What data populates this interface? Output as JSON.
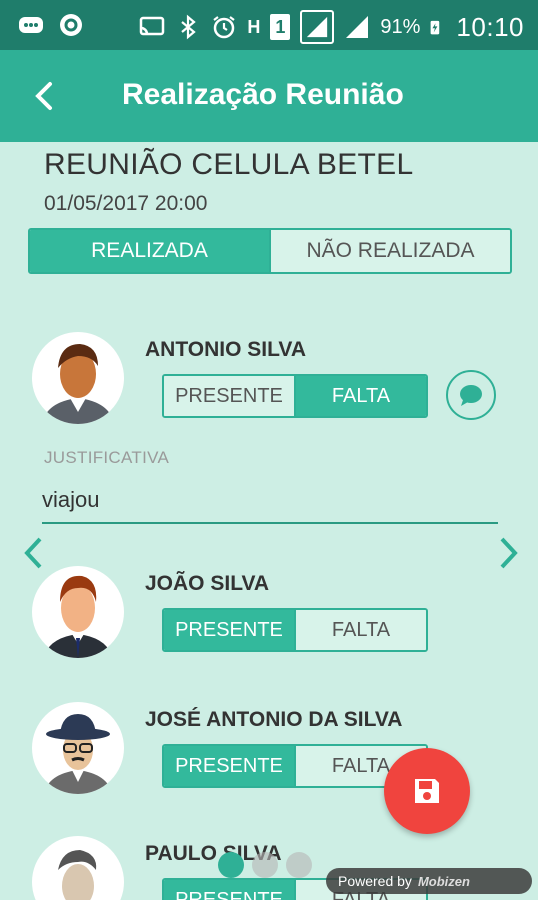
{
  "status_bar": {
    "battery": "91%",
    "time": "10:10",
    "network_label": "H",
    "sim_label": "1"
  },
  "app_bar": {
    "title": "Realização Reunião"
  },
  "meeting": {
    "title": "REUNIÃO CELULA BETEL",
    "datetime": "01/05/2017 20:00"
  },
  "status_toggle": {
    "options": [
      "REALIZADA",
      "NÃO REALIZADA"
    ],
    "selected": "REALIZADA"
  },
  "attendance_options": [
    "PRESENTE",
    "FALTA"
  ],
  "members": [
    {
      "name": "ANTONIO SILVA",
      "status": "FALTA"
    },
    {
      "name": "JOÃO SILVA",
      "status": "PRESENTE"
    },
    {
      "name": "JOSÉ ANTONIO DA SILVA",
      "status": "PRESENTE"
    },
    {
      "name": "PAULO SILVA",
      "status": "PRESENTE"
    }
  ],
  "justification": {
    "label": "JUSTIFICATIVA",
    "value": "viajou"
  },
  "watermark": {
    "text": "Powered by",
    "logo": "Mobizen"
  },
  "colors": {
    "primary": "#2fb096",
    "status_bar": "#1f7d6b",
    "background": "#cdeee4",
    "fab": "#f0443e"
  },
  "icons": [
    "back-arrow-icon",
    "chat-bubble-icon",
    "save-icon",
    "chevron-left-icon",
    "chevron-right-icon"
  ]
}
